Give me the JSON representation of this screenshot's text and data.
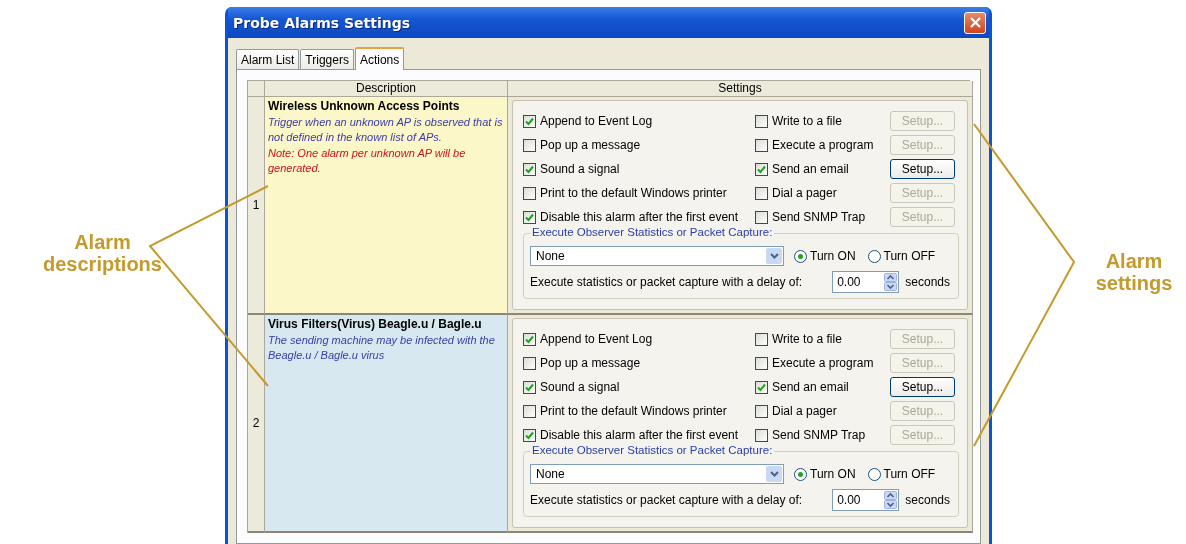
{
  "window": {
    "title": "Probe Alarms Settings"
  },
  "tabs": [
    {
      "label": "Alarm List",
      "selected": false
    },
    {
      "label": "Triggers",
      "selected": false
    },
    {
      "label": "Actions",
      "selected": true
    }
  ],
  "table": {
    "columns": [
      "Description",
      "Settings"
    ],
    "rows": [
      {
        "number": "1",
        "color": "#fbf7c8",
        "title": "Wireless Unknown Access Points",
        "description": [
          {
            "kind": "info",
            "text": "Trigger when an unknown AP is observed that is not defined in the known list of APs."
          },
          {
            "kind": "note",
            "text": "Note: One alarm per unknown AP will be generated."
          }
        ],
        "left_options": [
          {
            "label": "Append to Event Log",
            "checked": true
          },
          {
            "label": "Pop up a message",
            "checked": false
          },
          {
            "label": "Sound a signal",
            "checked": true
          },
          {
            "label": "Print to the default Windows printer",
            "checked": false
          },
          {
            "label": "Disable this alarm after the first event",
            "checked": true
          }
        ],
        "right_options": [
          {
            "label": "Write to a file",
            "checked": false,
            "setup": {
              "label": "Setup...",
              "disabled": true
            }
          },
          {
            "label": "Execute a program",
            "checked": false,
            "setup": {
              "label": "Setup...",
              "disabled": true
            }
          },
          {
            "label": "Send an email",
            "checked": true,
            "setup": {
              "label": "Setup...",
              "disabled": false
            }
          },
          {
            "label": "Dial a pager",
            "checked": false,
            "setup": {
              "label": "Setup...",
              "disabled": true
            }
          },
          {
            "label": "Send SNMP Trap",
            "checked": false,
            "setup": {
              "label": "Setup...",
              "disabled": true
            }
          }
        ],
        "capture": {
          "legend": "Execute Observer Statistics or Packet Capture:",
          "dropdown": "None",
          "radios": [
            {
              "label": "Turn ON",
              "selected": true
            },
            {
              "label": "Turn OFF",
              "selected": false
            }
          ],
          "delay_label": "Execute statistics or packet capture with a delay of:",
          "delay": "0.00",
          "unit": "seconds"
        }
      },
      {
        "number": "2",
        "color": "#d8e8f0",
        "title": "Virus Filters(Virus) Beagle.u / Bagle.u",
        "description": [
          {
            "kind": "info",
            "text": "The sending machine may be infected with the Beagle.u / Bagle.u virus"
          }
        ],
        "left_options": [
          {
            "label": "Append to Event Log",
            "checked": true
          },
          {
            "label": "Pop up a message",
            "checked": false
          },
          {
            "label": "Sound a signal",
            "checked": true
          },
          {
            "label": "Print to the default Windows printer",
            "checked": false
          },
          {
            "label": "Disable this alarm after the first event",
            "checked": true
          }
        ],
        "right_options": [
          {
            "label": "Write to a file",
            "checked": false,
            "setup": {
              "label": "Setup...",
              "disabled": true
            }
          },
          {
            "label": "Execute a program",
            "checked": false,
            "setup": {
              "label": "Setup...",
              "disabled": true
            }
          },
          {
            "label": "Send an email",
            "checked": true,
            "setup": {
              "label": "Setup...",
              "disabled": false
            }
          },
          {
            "label": "Dial a pager",
            "checked": false,
            "setup": {
              "label": "Setup...",
              "disabled": true
            }
          },
          {
            "label": "Send SNMP Trap",
            "checked": false,
            "setup": {
              "label": "Setup...",
              "disabled": true
            }
          }
        ],
        "capture": {
          "legend": "Execute Observer Statistics or Packet Capture:",
          "dropdown": "None",
          "radios": [
            {
              "label": "Turn ON",
              "selected": true
            },
            {
              "label": "Turn OFF",
              "selected": false
            }
          ],
          "delay_label": "Execute statistics or packet capture with a delay of:",
          "delay": "0.00",
          "unit": "seconds"
        }
      }
    ]
  },
  "callouts": [
    {
      "kind": "left",
      "text": "Alarm descriptions"
    },
    {
      "kind": "right",
      "text": "Alarm settings"
    }
  ]
}
